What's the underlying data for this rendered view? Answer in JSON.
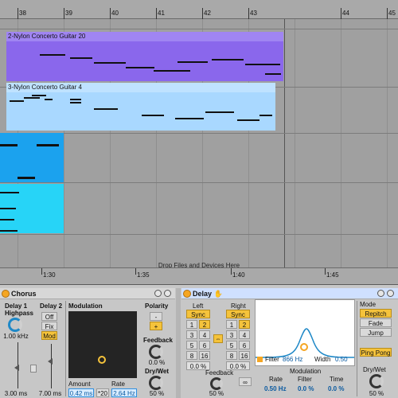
{
  "ruler": {
    "bars": [
      "38",
      "39",
      "40",
      "41",
      "42",
      "43",
      "44",
      "45"
    ]
  },
  "tracks": [
    {
      "clip_name": "2-Nylon Concerto Guitar 20",
      "color": "#9a7bf2"
    },
    {
      "clip_name": "3-Nylon Concerto Guitar 4",
      "color": "#a9d8ff"
    },
    {
      "clip_name": "",
      "color": "#1ba2ee"
    },
    {
      "clip_name": "",
      "color": "#27d4f7"
    }
  ],
  "dropzone": {
    "text": "Drop Files and Devices Here"
  },
  "timeruler": {
    "labels": [
      "1:30",
      "1:35",
      "1:40",
      "1:45"
    ]
  },
  "chorus": {
    "title": "Chorus",
    "delay1_label": "Delay 1",
    "highpass_label": "Highpass",
    "highpass_value": "1.00 kHz",
    "delay1_value": "3.00 ms",
    "delay2_label": "Delay 2",
    "off_label": "Off",
    "fix_label": "Fix",
    "mod_label": "Mod",
    "delay2_value": "7.00 ms",
    "modulation_label": "Modulation",
    "amount_label": "Amount",
    "amount_value": "0.42 ms",
    "x20_label": "*20",
    "rate_label": "Rate",
    "rate_value": "2.64 Hz",
    "polarity_label": "Polarity",
    "minus_label": "-",
    "plus_label": "+",
    "feedback_label": "Feedback",
    "feedback_value": "0.0 %",
    "drywet_label": "Dry/Wet",
    "drywet_value": "50 %"
  },
  "delay": {
    "title": "Delay",
    "left_label": "Left",
    "right_label": "Right",
    "sync_label": "Sync",
    "left_beats": [
      "1",
      "2",
      "3",
      "4",
      "5",
      "6",
      "8",
      "16"
    ],
    "right_beats": [
      "1",
      "2",
      "3",
      "4",
      "5",
      "6",
      "8",
      "16"
    ],
    "left_offset": "0.0 %",
    "right_offset": "0.0 %",
    "filter_label": "Filter",
    "filter_value": "866 Hz",
    "width_label": "Width",
    "width_value": "0.50",
    "modulation_label": "Modulation",
    "rate_label": "Rate",
    "rate_value": "0.50 Hz",
    "mod_filter_label": "Filter",
    "mod_filter_value": "0.0 %",
    "time_label": "Time",
    "time_value": "0.0 %",
    "feedback_label": "Feedback",
    "feedback_value": "50 %",
    "freeze_label": "∞",
    "mode_label": "Mode",
    "repitch_label": "Repitch",
    "fade_label": "Fade",
    "jump_label": "Jump",
    "pingpong_label": "Ping Pong",
    "drywet_label": "Dry/Wet",
    "drywet_value": "50 %"
  },
  "colors": {
    "accent": "#f5c33b",
    "selection_blue": "#2e8fe0"
  }
}
